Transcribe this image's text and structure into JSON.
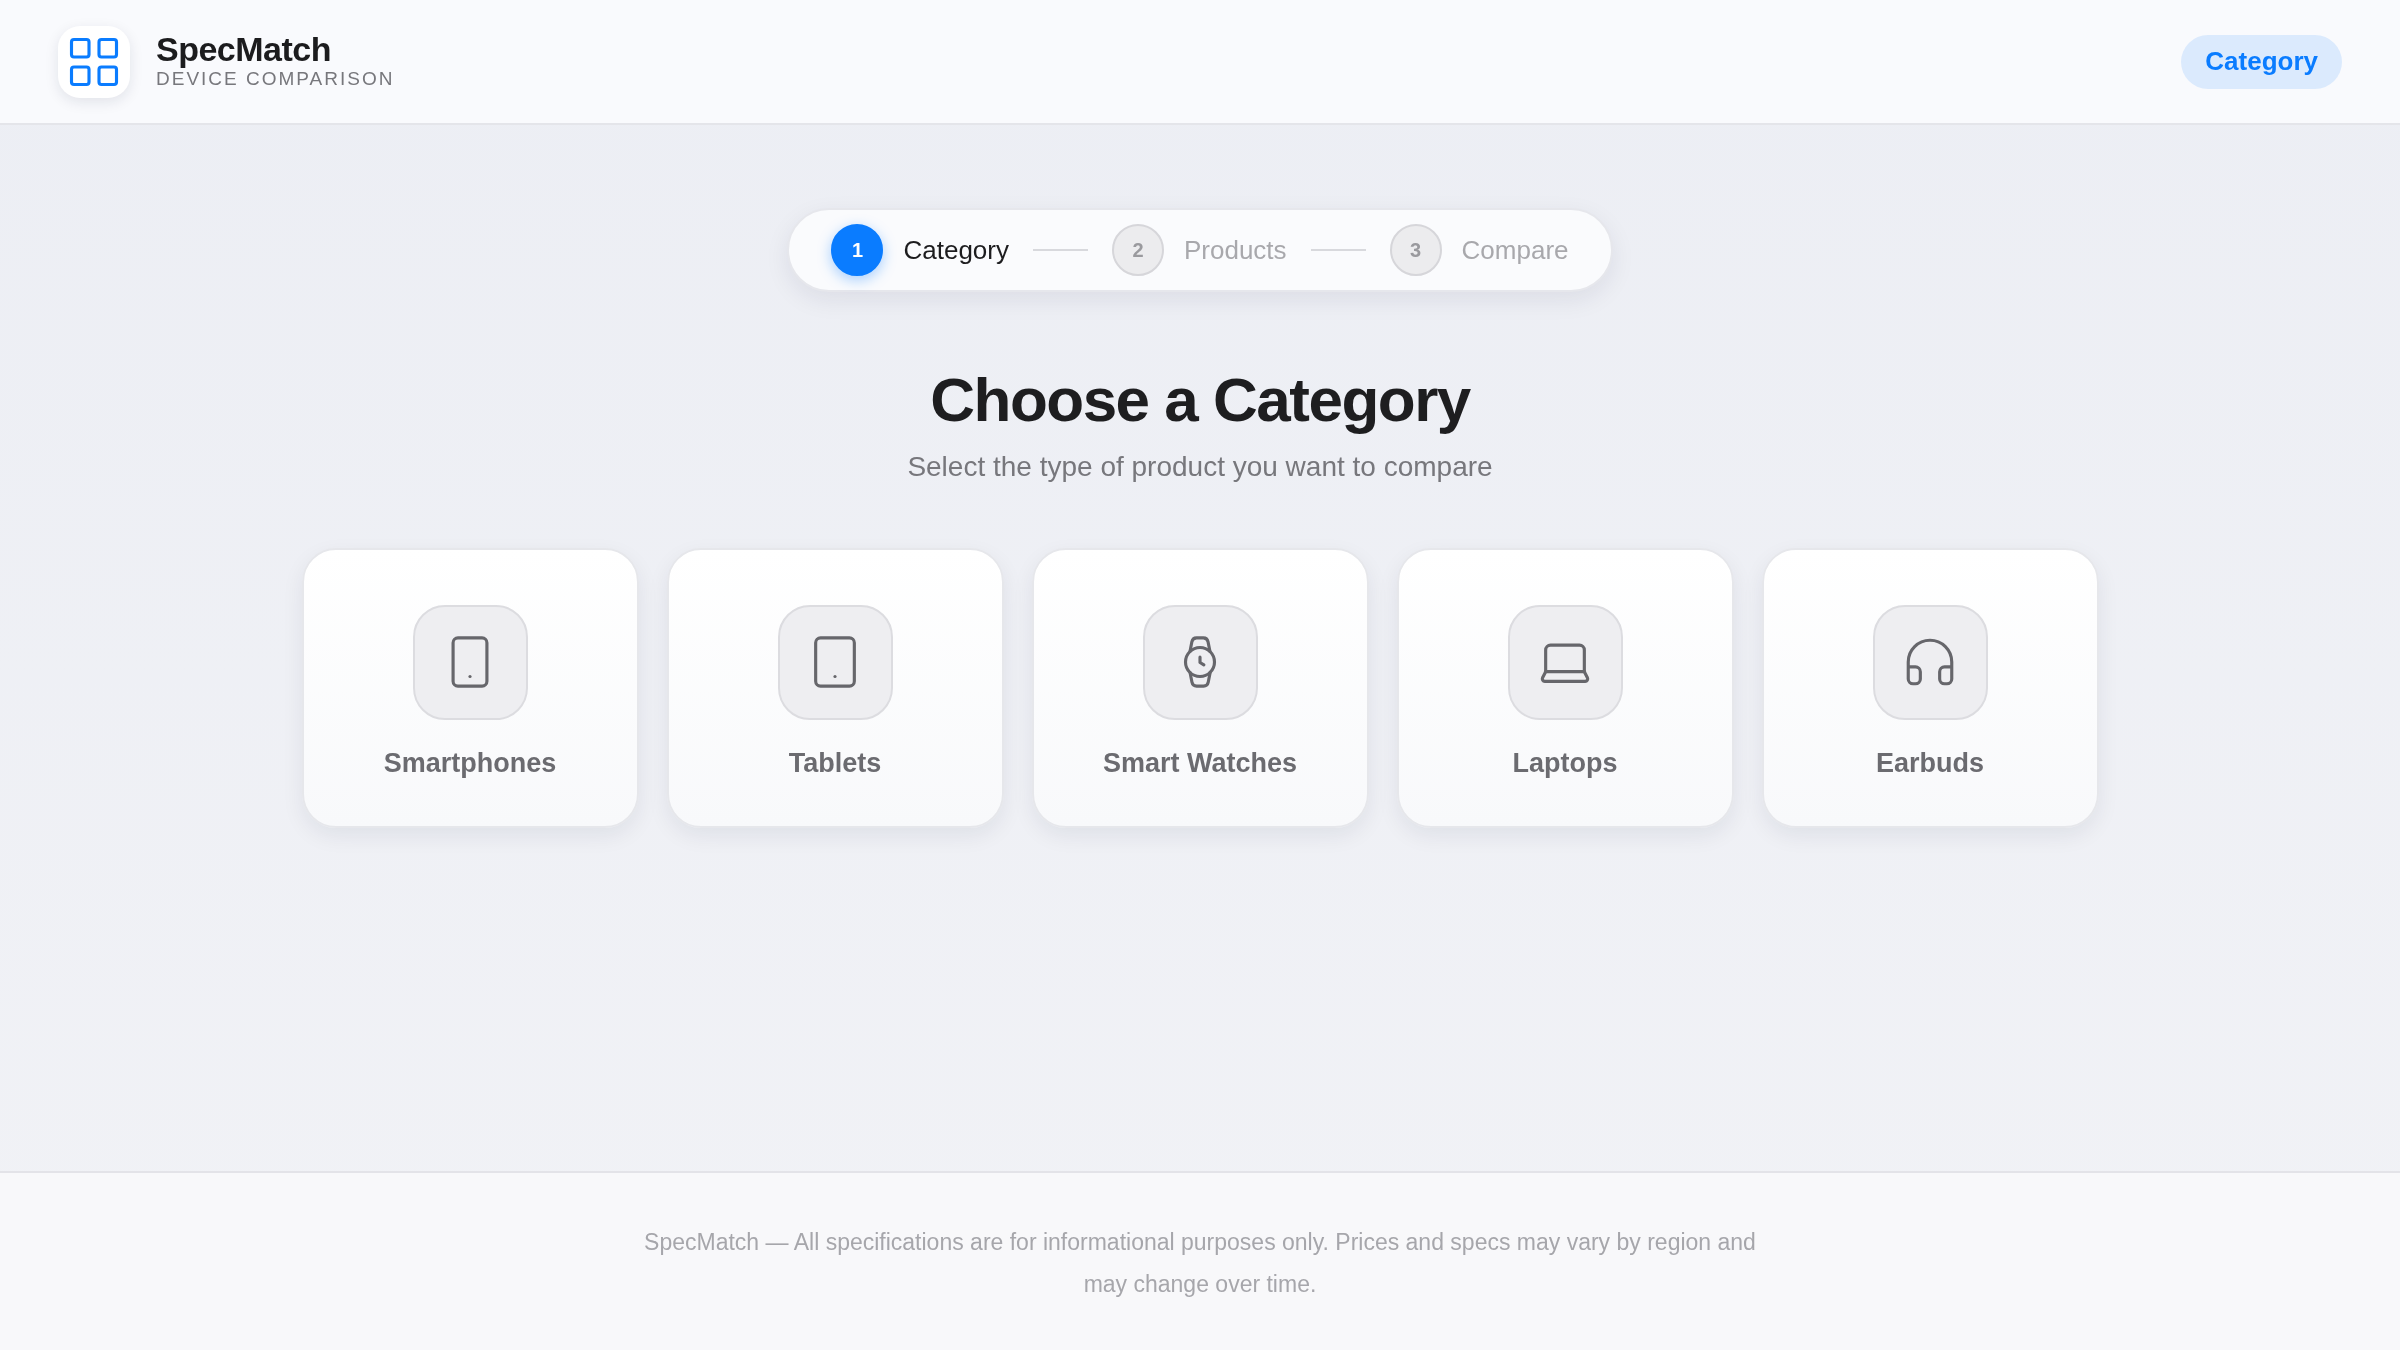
{
  "header": {
    "brand": {
      "name": "SpecMatch",
      "tagline": "DEVICE COMPARISON"
    },
    "current_step_badge": "Category"
  },
  "stepper": [
    {
      "number": "1",
      "label": "Category",
      "selected": true
    },
    {
      "number": "2",
      "label": "Products",
      "selected": false
    },
    {
      "number": "3",
      "label": "Compare",
      "selected": false
    }
  ],
  "page": {
    "title": "Choose a Category",
    "subtitle": "Select the type of product you want to compare"
  },
  "categories": [
    {
      "kind": "smartphone",
      "label": "Smartphones"
    },
    {
      "kind": "tablet",
      "label": "Tablets"
    },
    {
      "kind": "watch",
      "label": "Smart Watches"
    },
    {
      "kind": "laptop",
      "label": "Laptops"
    },
    {
      "kind": "earbuds",
      "label": "Earbuds"
    }
  ],
  "footer": {
    "text": "SpecMatch — All specifications are for informational purposes only. Prices and specs may vary by region and may change over time."
  }
}
